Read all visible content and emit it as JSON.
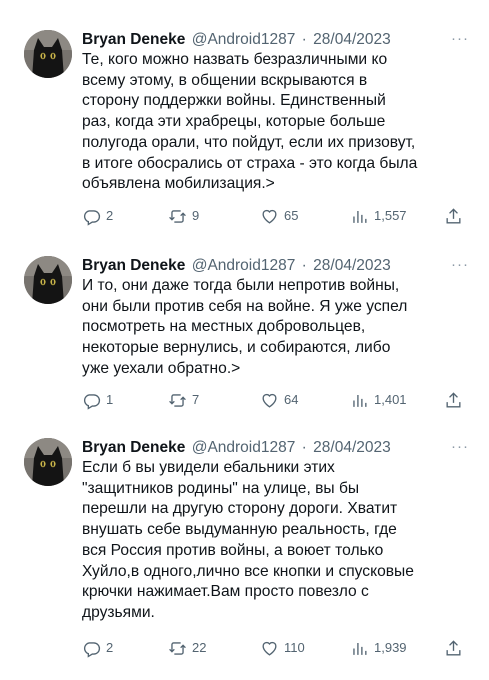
{
  "tweets": [
    {
      "name": "Bryan Deneke",
      "handle": "@Android1287",
      "separator": "·",
      "date": "28/04/2023",
      "text": "Те, кого можно назвать безразличными ко\nвсему этому, в общении вскрываются в\nсторону поддержки войны. Единственный\nраз, когда эти храбрецы, которые больше\nполугода орали, что пойдут, если их призовут,\nв итоге обосрались от страха - это когда была\nобъявлена мобилизация.>",
      "replies": "2",
      "retweets": "9",
      "likes": "65",
      "views": "1,557"
    },
    {
      "name": "Bryan Deneke",
      "handle": "@Android1287",
      "separator": "·",
      "date": "28/04/2023",
      "text": "И то, они даже тогда были непротив войны,\nони были против себя на войне. Я уже успел\nпосмотреть на местных добровольцев,\nнекоторые вернулись, и собираются, либо\nуже уехали обратно.>",
      "replies": "1",
      "retweets": "7",
      "likes": "64",
      "views": "1,401"
    },
    {
      "name": "Bryan Deneke",
      "handle": "@Android1287",
      "separator": "·",
      "date": "28/04/2023",
      "text": "Если б вы увидели ебальники этих\n\"защитников родины\" на улице, вы бы\nперешли на другую сторону дороги. Хватит\nвнушать себе выдуманную реальность, где\nвся Россия против войны, а воюет только\nХуйло,в одного,лично все кнопки и спусковые\nкрючки нажимает.Вам просто повезло с\nдрузьями.",
      "replies": "2",
      "retweets": "22",
      "likes": "110",
      "views": "1,939"
    }
  ],
  "more_label": "···",
  "icons": {
    "reply": "reply-icon",
    "retweet": "retweet-icon",
    "like": "heart-icon",
    "views": "views-icon",
    "share": "share-icon"
  },
  "colors": {
    "text": "#0f1419",
    "secondary": "#536471",
    "background": "#ffffff"
  }
}
